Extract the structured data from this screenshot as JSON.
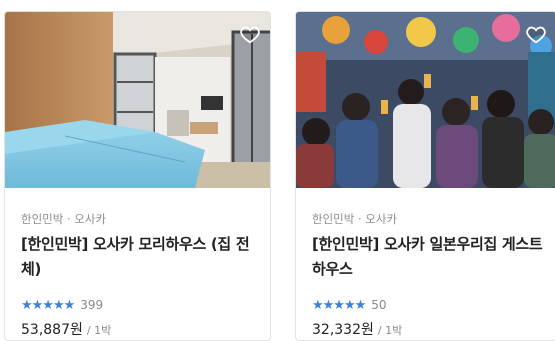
{
  "listings": [
    {
      "category": "한인민박 · 오사카",
      "title": "[한인민박] 오사카 모리하우스 (집 전체)",
      "stars": "★★★★★",
      "rating_count": "399",
      "price": "53,887원",
      "price_unit": "/ 1박",
      "image_desc": "bright apartment room with light blue bed and sliding glass door"
    },
    {
      "category": "한인민박 · 오사카",
      "title": "[한인민박] 오사카 일본우리집 게스트하우스",
      "stars": "★★★★★",
      "rating_count": "50",
      "price": "32,332원",
      "price_unit": "/ 1박",
      "image_desc": "crowded party with guests toasting under colorful decorations"
    }
  ],
  "colors": {
    "star": "#3b82d6",
    "text": "#222222",
    "muted": "#8d8d8d"
  },
  "icons": [
    "heart-icon"
  ]
}
